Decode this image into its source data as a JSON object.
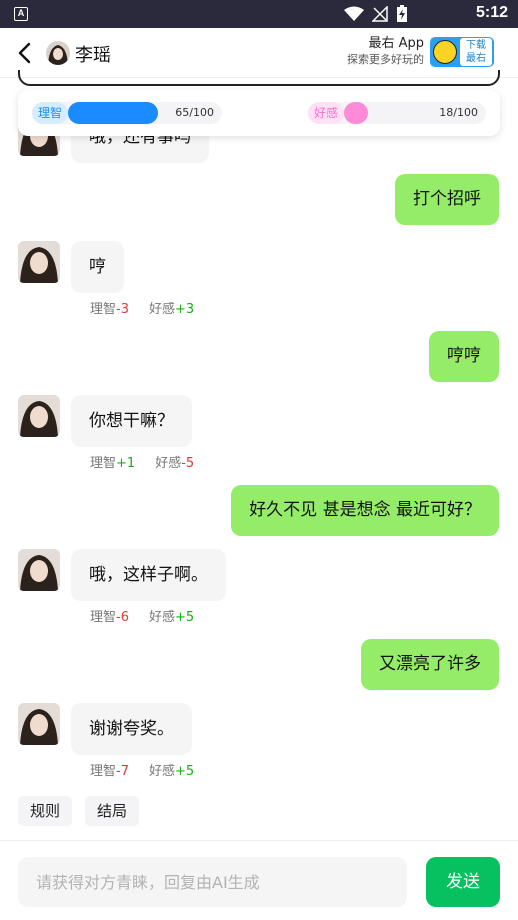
{
  "status_bar": {
    "time": "5:12",
    "app_badge": "A"
  },
  "header": {
    "name": "李瑶",
    "promo_title": "最右 App",
    "promo_subtitle": "探索更多好玩的",
    "download_label_1": "下载",
    "download_label_2": "最右"
  },
  "stats": {
    "reason_label": "理智",
    "reason_value": "65/100",
    "reason_fraction": 0.65,
    "favor_label": "好感",
    "favor_value": "18/100",
    "favor_fraction": 0.18,
    "reason_color": "#1a8cff",
    "favor_color": "#ff8ad8"
  },
  "messages": [
    {
      "side": "left",
      "text": "哦，还有事吗",
      "partial": true
    },
    {
      "side": "right",
      "text": "打个招呼"
    },
    {
      "side": "left",
      "text": "哼",
      "reason_label": "理智",
      "reason_delta": "-3",
      "favor_label": "好感",
      "favor_delta": "+3"
    },
    {
      "side": "right",
      "text": "哼哼"
    },
    {
      "side": "left",
      "text": "你想干嘛？",
      "reason_label": "理智",
      "reason_delta": "+1",
      "favor_label": "好感",
      "favor_delta": "-5"
    },
    {
      "side": "right",
      "text": "好久不见 甚是想念 最近可好？"
    },
    {
      "side": "left",
      "text": "哦，这样子啊。",
      "reason_label": "理智",
      "reason_delta": "-6",
      "favor_label": "好感",
      "favor_delta": "+5"
    },
    {
      "side": "right",
      "text": "又漂亮了许多"
    },
    {
      "side": "left",
      "text": "谢谢夸奖。",
      "reason_label": "理智",
      "reason_delta": "-7",
      "favor_label": "好感",
      "favor_delta": "+5"
    }
  ],
  "chips": [
    "规则",
    "结局"
  ],
  "input": {
    "placeholder": "请获得对方青睐，回复由AI生成",
    "send_label": "发送"
  },
  "colors": {
    "user_bubble": "#95ec69",
    "bot_bubble": "#f5f5f5",
    "send_button": "#07c160",
    "positive": "#1aad19",
    "negative": "#e53935"
  }
}
